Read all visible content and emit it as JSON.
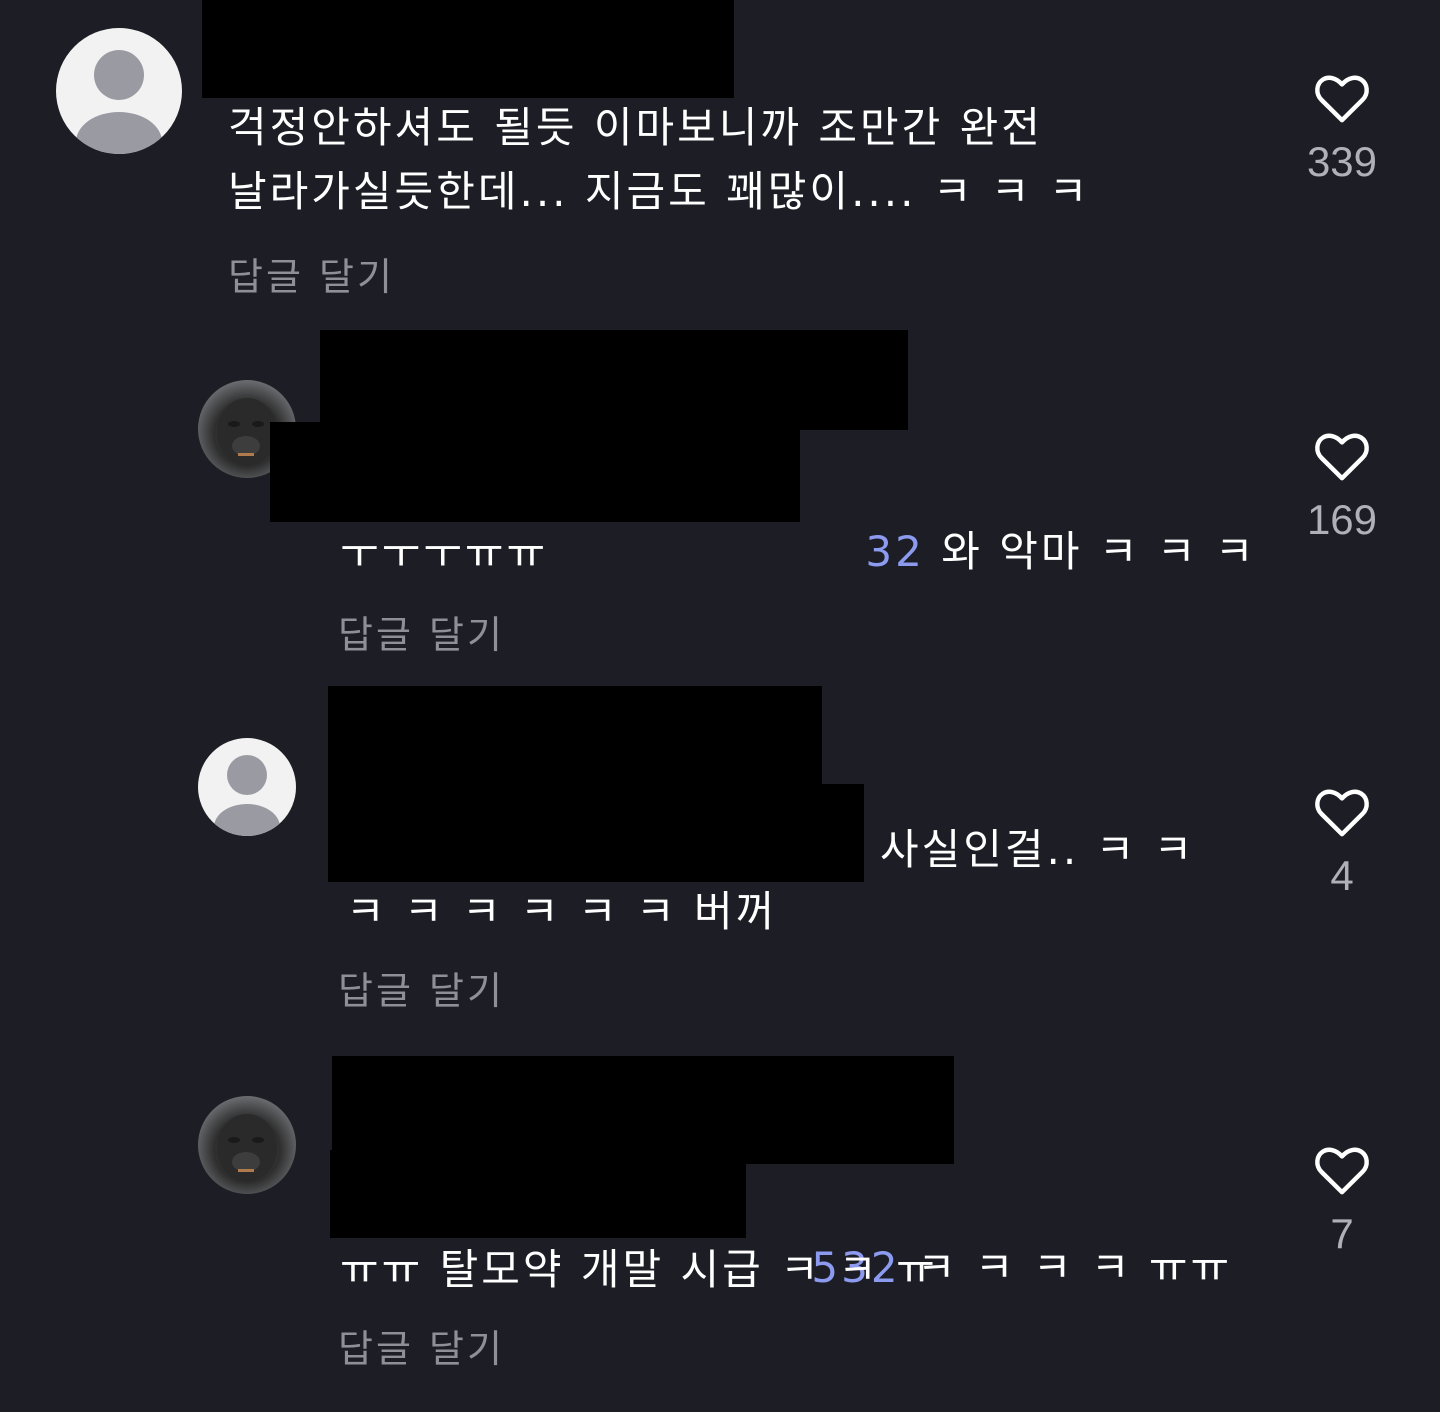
{
  "comments": [
    {
      "avatar": "default-avatar",
      "text_lines": [
        "걱정안하셔도 될듯 이마보니까 조만간 완전",
        "날라가실듯한데... 지금도 꽤많이.... ㅋ ㅋ ㅋ"
      ],
      "reply_label": "답글 달기",
      "likes": "339"
    },
    {
      "avatar": "gorilla-avatar",
      "mention": "32",
      "text_line1_rest": " 와 악마 ㅋ ㅋ ㅋ",
      "text_line2": "ㅜㅜㅜㅠㅠ",
      "reply_label": "답글 달기",
      "likes": "169"
    },
    {
      "avatar": "default-avatar",
      "text_line1_rest": "사실인걸.. ㅋ ㅋ",
      "text_line2": "ㅋ ㅋ ㅋ ㅋ ㅋ ㅋ 버꺼",
      "reply_label": "답글 달기",
      "likes": "4"
    },
    {
      "avatar": "gorilla-avatar",
      "mention": "532",
      "text_line1_rest": " ㅋ ㅋ ㅋ ㅋ ㅠㅠ",
      "text_line2": "ㅠㅠ 탈모약 개말 시급 ㅋ ㅋ ㅠ",
      "reply_label": "답글 달기",
      "likes": "7"
    }
  ],
  "icons": {
    "like": "heart-outline-icon"
  },
  "colors": {
    "background": "#1d1e25",
    "mention": "#8c9bf0",
    "muted": "#8f9097"
  }
}
